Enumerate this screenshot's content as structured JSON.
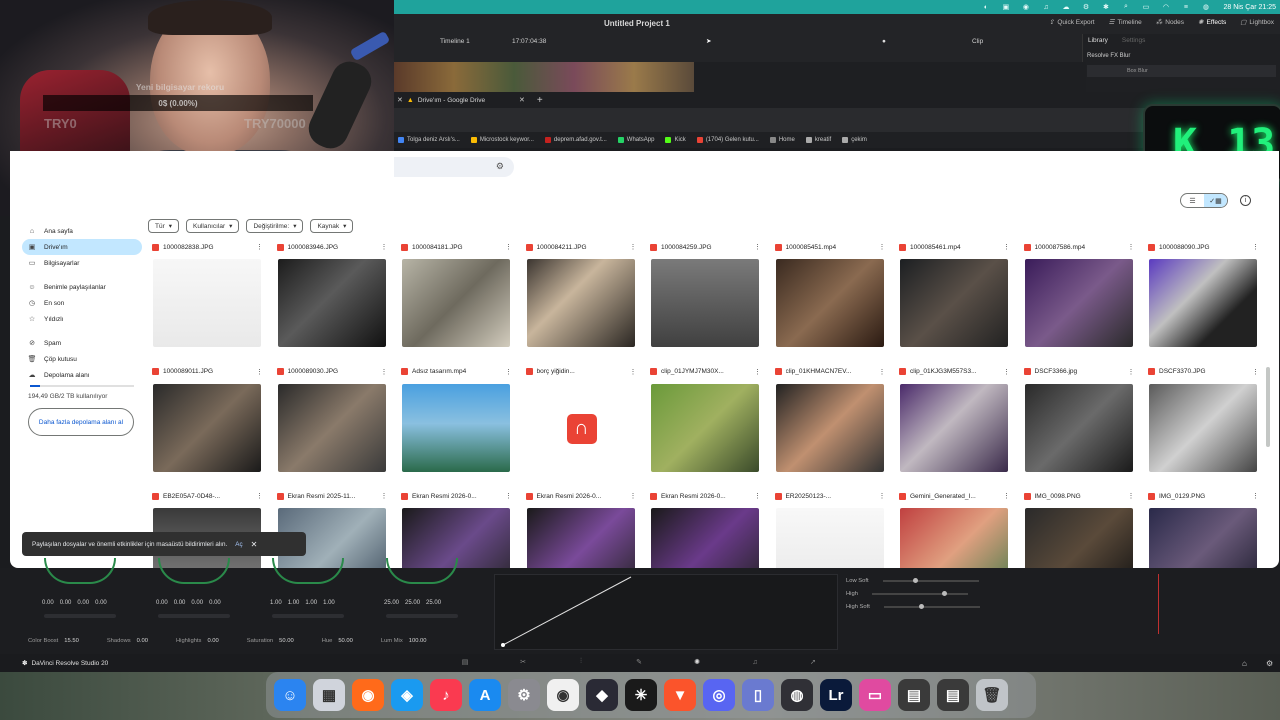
{
  "menubar": {
    "clock": "28 Nis Çar 21:25"
  },
  "resolve": {
    "project_title": "Untitled Project 1",
    "toolbar": {
      "quick_export": "Quick Export",
      "timeline": "Timeline",
      "nodes": "Nodes",
      "effects": "Effects",
      "lightbox": "Lightbox"
    },
    "timeline_name": "Timeline 1",
    "timecode": "17:07:04:38",
    "clip_label": "Clip",
    "library_tab": "Library",
    "settings_tab": "Settings",
    "fx_header": "Resolve FX Blur",
    "fx_item": "Box Blur",
    "app_name": "DaVinci Resolve Studio 20",
    "wheels": [
      {
        "values": [
          "0.00",
          "0.00",
          "0.00",
          "0.00"
        ]
      },
      {
        "values": [
          "0.00",
          "0.00",
          "0.00",
          "0.00"
        ]
      },
      {
        "values": [
          "1.00",
          "1.00",
          "1.00",
          "1.00"
        ]
      },
      {
        "values": [
          "25.00",
          "25.00",
          "25.00"
        ]
      }
    ],
    "params": [
      {
        "label": "Color Boost",
        "value": "15.50"
      },
      {
        "label": "Shadows",
        "value": "0.00"
      },
      {
        "label": "Highlights",
        "value": "0.00"
      },
      {
        "label": "Saturation",
        "value": "50.00"
      },
      {
        "label": "Hue",
        "value": "50.00"
      },
      {
        "label": "Lum Mix",
        "value": "100.00"
      }
    ],
    "soft": [
      "Low Soft",
      "High",
      "High Soft"
    ]
  },
  "webcam": {
    "overlay_title": "Yeni bilgisayar rekoru",
    "overlay_value": "0$ (0.00%)",
    "left_tag": "TRY0",
    "right_tag": "TRY70000"
  },
  "kbadge": {
    "letter": "K",
    "digits": "13"
  },
  "chrome": {
    "tab_title": "Drive'ım - Google Drive",
    "new_tab": "+",
    "bookmarks": [
      {
        "label": "Tolga deniz Arslı's...",
        "color": "#4285f4"
      },
      {
        "label": "Microstock keywor...",
        "color": "#fbbc04"
      },
      {
        "label": "deprem.afad.gov.t...",
        "color": "#c5221f"
      },
      {
        "label": "WhatsApp",
        "color": "#25d366"
      },
      {
        "label": "Kick",
        "color": "#53fc18"
      },
      {
        "label": "(1704) Gelen kutu...",
        "color": "#ea4335"
      },
      {
        "label": "Home",
        "color": "#888888"
      },
      {
        "label": "kreatif",
        "color": "#aaaaaa"
      },
      {
        "label": "çekim",
        "color": "#aaaaaa"
      }
    ]
  },
  "drive": {
    "filters": [
      "Tür",
      "Kullanıcılar",
      "Değiştirilme:",
      "Kaynak"
    ],
    "sidebar": [
      {
        "label": "Ana sayfa",
        "icon": "⌂"
      },
      {
        "label": "Drive'ım",
        "icon": "▣",
        "active": true
      },
      {
        "label": "Bilgisayarlar",
        "icon": "▭"
      },
      {
        "gap": true
      },
      {
        "label": "Benimle paylaşılanlar",
        "icon": "☺"
      },
      {
        "label": "En son",
        "icon": "◷"
      },
      {
        "label": "Yıldızlı",
        "icon": "☆"
      },
      {
        "gap": true
      },
      {
        "label": "Spam",
        "icon": "⊘"
      },
      {
        "label": "Çöp kutusu",
        "icon": "🗑"
      },
      {
        "label": "Depolama alanı",
        "icon": "☁"
      }
    ],
    "storage": {
      "text": "194,49 GB/2 TB kullanılıyor",
      "fraction": 0.097
    },
    "more_storage": "Daha fazla depolama alanı al",
    "snackbar": {
      "text": "Paylaşılan dosyalar ve önemli etkinlikler için masaüstü bildirimleri alın.",
      "action": "Aç"
    },
    "files": [
      {
        "name": "1000082838.JPG",
        "bg": "linear-gradient(#f7f7f7, #e9e9e9)"
      },
      {
        "name": "1000083946.JPG",
        "bg": "linear-gradient(135deg, #1c1c1c, #5a5a5a 45%, #111)"
      },
      {
        "name": "1000084181.JPG",
        "bg": "linear-gradient(135deg, #b7b4a6, #6e6a5e 50%, #d2ccbd)"
      },
      {
        "name": "1000084211.JPG",
        "bg": "linear-gradient(135deg, #3b3530, #c8b59c 40%, #2a2622)"
      },
      {
        "name": "1000084259.JPG",
        "bg": "linear-gradient(#7a7a7a, #404040)"
      },
      {
        "name": "1000085451.mp4",
        "bg": "linear-gradient(135deg, #3a2a20, #8a6a50 50%, #2a1a12)"
      },
      {
        "name": "1000085461.mp4",
        "bg": "linear-gradient(135deg, #1c1f22, #5a5048 50%, #222)"
      },
      {
        "name": "1000087586.mp4",
        "bg": "linear-gradient(135deg, #3a1c5a, #7a5a8a 50%, #2a2a2a)"
      },
      {
        "name": "1000088090.JPG",
        "bg": "linear-gradient(135deg, #5a3ac0, #c0c0c0 40%, #222 70%)"
      },
      {
        "name": "1000089011.JPG",
        "bg": "linear-gradient(135deg, #2a2a2a, #7a6a5a 50%, #1a1a1a)"
      },
      {
        "name": "1000089030.JPG",
        "bg": "linear-gradient(135deg, #2a2a2a, #8a7a6a 50%, #3a3a3a)"
      },
      {
        "name": "Adsız tasarım.mp4",
        "bg": "linear-gradient(#4aa0e0, #8ac0e0 45%, #2a6a4a)"
      },
      {
        "name": "borç yiğidin...",
        "bg": "#ffffff"
      },
      {
        "name": "clip_01JYMJ7M30X...",
        "bg": "linear-gradient(135deg, #6a9a3a, #a0b060 50%, #3a4a2a)"
      },
      {
        "name": "clip_01KHMACN7EV...",
        "bg": "linear-gradient(135deg, #222, #c09070 50%, #333)"
      },
      {
        "name": "clip_01KJG3M557S3...",
        "bg": "linear-gradient(135deg, #4a2a6a, #c0b8c0 45%, #3a2a4a)"
      },
      {
        "name": "DSCF3366.jpg",
        "bg": "linear-gradient(135deg, #2a2a2a, #6a6a6a 50%, #1a1a1a)"
      },
      {
        "name": "DSCF3370.JPG",
        "bg": "linear-gradient(135deg, #5a5a5a, #d0d0d0 50%, #444)"
      },
      {
        "name": "EB2E05A7-0D48-...",
        "bg": "linear-gradient(#3a3a3a, #8a8a8a)"
      },
      {
        "name": "Ekran Resmi 2025-11...",
        "bg": "linear-gradient(135deg, #5a6a7a, #a0b0b8 50%, #3a4a5a)"
      },
      {
        "name": "Ekran Resmi 2026-0...",
        "bg": "linear-gradient(135deg, #1a1a1a, #6a4a8a 50%, #222)"
      },
      {
        "name": "Ekran Resmi 2026-0...",
        "bg": "linear-gradient(135deg, #1a1a1a, #7a4a9a 50%, #222)"
      },
      {
        "name": "Ekran Resmi 2026-0...",
        "bg": "linear-gradient(135deg, #1a1a1a, #6a3a8a 50%, #222)"
      },
      {
        "name": "ER20250123-...",
        "bg": "linear-gradient(#f8f8f8, #e8e8e8)"
      },
      {
        "name": "Gemini_Generated_I...",
        "bg": "linear-gradient(135deg, #c04040, #e0a080 50%, #4a7a4a)"
      },
      {
        "name": "IMG_0098.PNG",
        "bg": "linear-gradient(135deg, #2a2a2a, #5a4a3a 50%, #111)"
      },
      {
        "name": "IMG_0129.PNG",
        "bg": "linear-gradient(135deg, #2a2a4a, #6a5a7a 50%, #1a1a2a)"
      }
    ]
  },
  "dock": [
    {
      "name": "finder-icon",
      "bg": "#2b84f0",
      "glyph": "☺"
    },
    {
      "name": "launchpad-icon",
      "bg": "#d0d4dc",
      "glyph": "▦"
    },
    {
      "name": "firefox-icon",
      "bg": "#ff6a1a",
      "glyph": "◉"
    },
    {
      "name": "safari-icon",
      "bg": "#1a9af0",
      "glyph": "◈"
    },
    {
      "name": "music-icon",
      "bg": "#fa3a50",
      "glyph": "♪"
    },
    {
      "name": "app-store-icon",
      "bg": "#1a8af0",
      "glyph": "A"
    },
    {
      "name": "settings-icon",
      "bg": "#8a8a90",
      "glyph": "⚙"
    },
    {
      "name": "chrome-icon",
      "bg": "#f0f0f0",
      "glyph": "◉"
    },
    {
      "name": "resolve-icon",
      "bg": "#2a2a35",
      "glyph": "◆"
    },
    {
      "name": "perplexity-icon",
      "bg": "#1a1a1a",
      "glyph": "✳"
    },
    {
      "name": "brave-icon",
      "bg": "#fb542b",
      "glyph": "▼"
    },
    {
      "name": "discord-icon",
      "bg": "#5865f2",
      "glyph": "◎"
    },
    {
      "name": "simulator-icon",
      "bg": "#6a7ad0",
      "glyph": "▯"
    },
    {
      "name": "obs-icon",
      "bg": "#303036",
      "glyph": "◍"
    },
    {
      "name": "lightroom-icon",
      "bg": "#0a1a3a",
      "glyph": "Lr"
    },
    {
      "name": "cleanmymac-icon",
      "bg": "#e04aa0",
      "glyph": "▭"
    },
    {
      "name": "window-icon",
      "bg": "#3a3a3a",
      "glyph": "▤"
    },
    {
      "name": "window-icon-2",
      "bg": "#3a3a3a",
      "glyph": "▤"
    },
    {
      "name": "trash-icon",
      "bg": "#c0c4c8",
      "glyph": "🗑"
    }
  ]
}
